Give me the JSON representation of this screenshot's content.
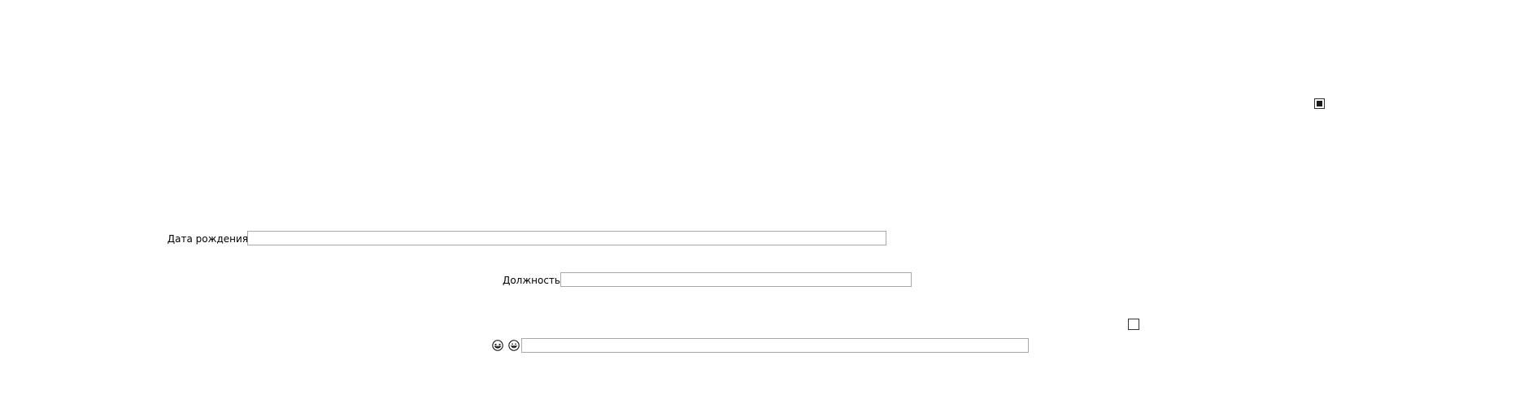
{
  "checkbox_top": {
    "checked": true
  },
  "birth_date": {
    "label": "Дата рождения",
    "value": "",
    "placeholder": ""
  },
  "position": {
    "label": "Должность",
    "value": "",
    "placeholder": ""
  },
  "checkbox_bottom": {
    "checked": false
  },
  "emoji_field": {
    "icons": [
      "laughing-face-icon",
      "grinning-face-icon"
    ],
    "value": "",
    "placeholder": ""
  }
}
